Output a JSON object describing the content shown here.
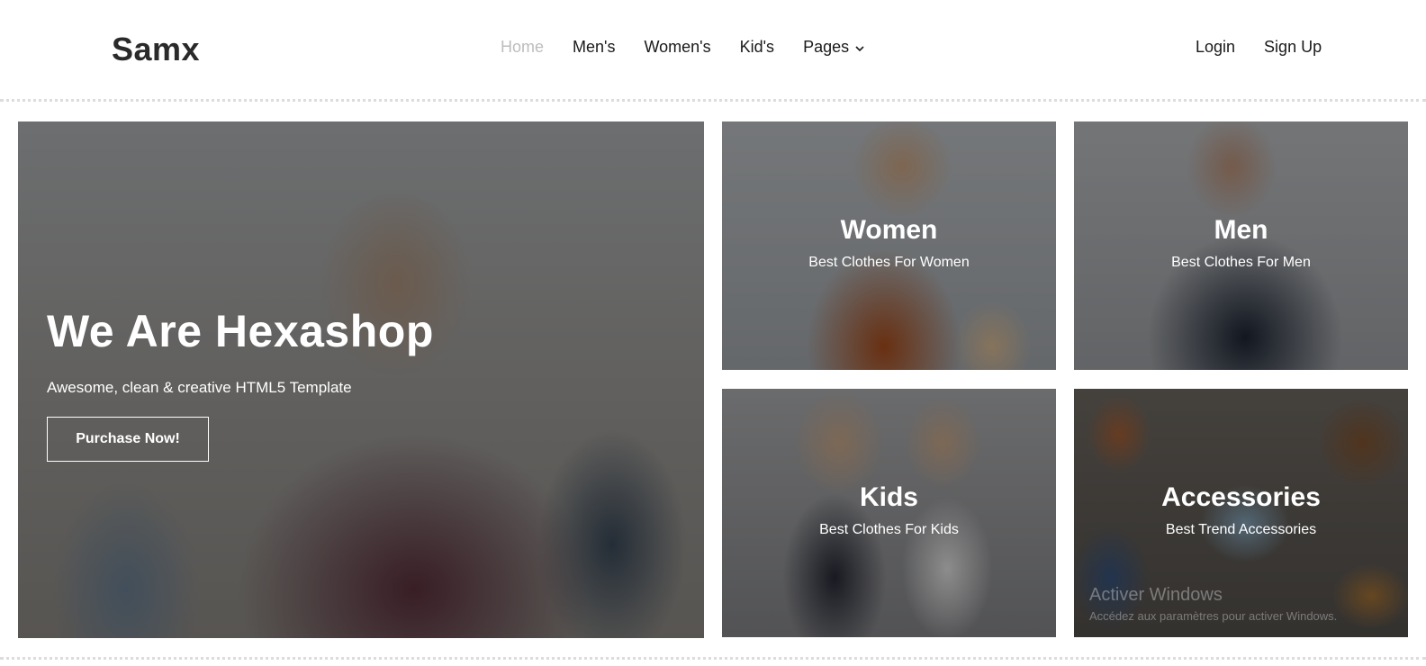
{
  "header": {
    "logo": "Samx",
    "nav": {
      "home": "Home",
      "mens": "Men's",
      "womens": "Women's",
      "kids": "Kid's",
      "pages": "Pages"
    },
    "auth": {
      "login": "Login",
      "signup": "Sign Up"
    }
  },
  "hero": {
    "title": "We Are Hexashop",
    "subtitle": "Awesome, clean & creative HTML5 Template",
    "button": "Purchase Now!"
  },
  "categories": [
    {
      "title": "Women",
      "subtitle": "Best Clothes For Women"
    },
    {
      "title": "Men",
      "subtitle": "Best Clothes For Men"
    },
    {
      "title": "Kids",
      "subtitle": "Best Clothes For Kids"
    },
    {
      "title": "Accessories",
      "subtitle": "Best Trend Accessories"
    }
  ],
  "watermark": {
    "line1": "Activer Windows",
    "line2": "Accédez aux paramètres pour activer Windows."
  },
  "colors": {
    "nav_active": "#bdbdbd",
    "text_dark": "#1a1a1a",
    "overlay": "rgba(0,0,0,0.42)"
  }
}
